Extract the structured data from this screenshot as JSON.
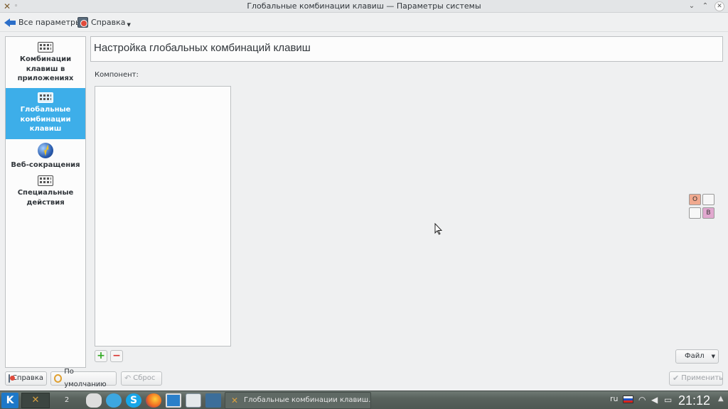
{
  "window": {
    "title": "Глобальные комбинации клавиш — Параметры системы",
    "minimize_glyph": "⌄",
    "maximize_glyph": "⌃",
    "close_glyph": "✕"
  },
  "toolbar": {
    "back_label": "Все параметры",
    "help_label": "Справка"
  },
  "sidebar": {
    "items": [
      {
        "label": "Комбинации клавиш в приложениях",
        "icon": "keyboard-icon",
        "active": false
      },
      {
        "label": "Глобальные комбинации клавиш",
        "icon": "keyboard-icon",
        "active": true
      },
      {
        "label": "Веб-сокращения",
        "icon": "globe-icon",
        "active": false
      },
      {
        "label": "Специальные действия",
        "icon": "keyboard-icon",
        "active": false
      }
    ]
  },
  "main": {
    "header": "Настройка глобальных комбинаций клавиш",
    "component_label": "Компонент:",
    "add_glyph": "+",
    "remove_glyph": "−",
    "file_button": "Файл"
  },
  "widget": {
    "cell_o": "O",
    "cell_b": "B"
  },
  "bottom_buttons": {
    "help": "Справка",
    "defaults": "По умолчанию",
    "reset": "Сброс",
    "apply": "Применить"
  },
  "taskbar": {
    "desktop_2": "2",
    "task_title": "Глобальные комбинации клавиш...",
    "language": "ru",
    "clock": "21:12"
  }
}
